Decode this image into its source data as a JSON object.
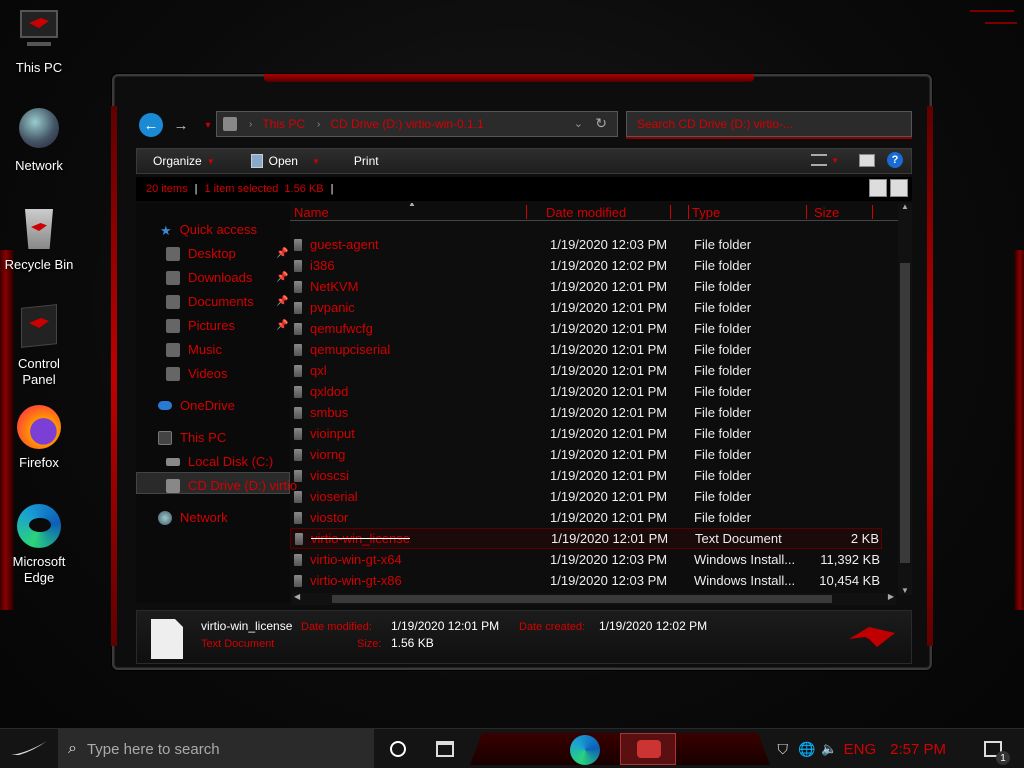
{
  "desktop": {
    "icons": [
      {
        "label": "This PC",
        "icon": "computer-icon"
      },
      {
        "label": "Network",
        "icon": "globe-icon"
      },
      {
        "label": "Recycle Bin",
        "icon": "recycle-bin-icon"
      },
      {
        "label": "Control Panel",
        "icon": "control-panel-icon"
      },
      {
        "label": "Firefox",
        "icon": "firefox-icon"
      },
      {
        "label": "Microsoft Edge",
        "icon": "edge-icon"
      }
    ]
  },
  "explorer": {
    "address": {
      "crumbs": [
        "This PC",
        "CD Drive (D:) virtio-win-0.1.1"
      ],
      "search_placeholder": "Search CD Drive (D:) virtio-..."
    },
    "toolbar": {
      "organize": "Organize",
      "open": "Open",
      "print": "Print"
    },
    "status": {
      "items": "20 items",
      "selected": "1 item selected",
      "size": "1.56 KB"
    },
    "nav": {
      "quick_access": "Quick access",
      "desktop": "Desktop",
      "downloads": "Downloads",
      "documents": "Documents",
      "pictures": "Pictures",
      "music": "Music",
      "videos": "Videos",
      "onedrive": "OneDrive",
      "this_pc": "This PC",
      "local_disk": "Local Disk (C:)",
      "cd_drive": "CD Drive (D:) virtio",
      "network": "Network"
    },
    "columns": {
      "name": "Name",
      "date": "Date modified",
      "type": "Type",
      "size": "Size"
    },
    "rows": [
      {
        "name": "guest-agent",
        "date": "1/19/2020 12:03 PM",
        "type": "File folder",
        "size": ""
      },
      {
        "name": "i386",
        "date": "1/19/2020 12:02 PM",
        "type": "File folder",
        "size": ""
      },
      {
        "name": "NetKVM",
        "date": "1/19/2020 12:01 PM",
        "type": "File folder",
        "size": ""
      },
      {
        "name": "pvpanic",
        "date": "1/19/2020 12:01 PM",
        "type": "File folder",
        "size": ""
      },
      {
        "name": "qemufwcfg",
        "date": "1/19/2020 12:01 PM",
        "type": "File folder",
        "size": ""
      },
      {
        "name": "qemupciserial",
        "date": "1/19/2020 12:01 PM",
        "type": "File folder",
        "size": ""
      },
      {
        "name": "qxl",
        "date": "1/19/2020 12:01 PM",
        "type": "File folder",
        "size": ""
      },
      {
        "name": "qxldod",
        "date": "1/19/2020 12:01 PM",
        "type": "File folder",
        "size": ""
      },
      {
        "name": "smbus",
        "date": "1/19/2020 12:01 PM",
        "type": "File folder",
        "size": ""
      },
      {
        "name": "vioinput",
        "date": "1/19/2020 12:01 PM",
        "type": "File folder",
        "size": ""
      },
      {
        "name": "viorng",
        "date": "1/19/2020 12:01 PM",
        "type": "File folder",
        "size": ""
      },
      {
        "name": "vioscsi",
        "date": "1/19/2020 12:01 PM",
        "type": "File folder",
        "size": ""
      },
      {
        "name": "vioserial",
        "date": "1/19/2020 12:01 PM",
        "type": "File folder",
        "size": ""
      },
      {
        "name": "viostor",
        "date": "1/19/2020 12:01 PM",
        "type": "File folder",
        "size": ""
      },
      {
        "name": "virtio-win_license",
        "date": "1/19/2020 12:01 PM",
        "type": "Text Document",
        "size": "2 KB"
      },
      {
        "name": "virtio-win-gt-x64",
        "date": "1/19/2020 12:03 PM",
        "type": "Windows Install...",
        "size": "11,392 KB"
      },
      {
        "name": "virtio-win-gt-x86",
        "date": "1/19/2020 12:03 PM",
        "type": "Windows Install...",
        "size": "10,454 KB"
      }
    ],
    "details": {
      "filename": "virtio-win_license",
      "filetype": "Text Document",
      "modified_label": "Date modified:",
      "modified_value": "1/19/2020 12:01 PM",
      "created_label": "Date created:",
      "created_value": "1/19/2020 12:02 PM",
      "size_label": "Size:",
      "size_value": "1.56 KB"
    }
  },
  "taskbar": {
    "search_placeholder": "Type here to search",
    "lang": "ENG",
    "time": "2:57 PM",
    "notification_count": "1"
  },
  "colors": {
    "accent_red": "#d40000",
    "win_blue": "#1a8ad4"
  }
}
